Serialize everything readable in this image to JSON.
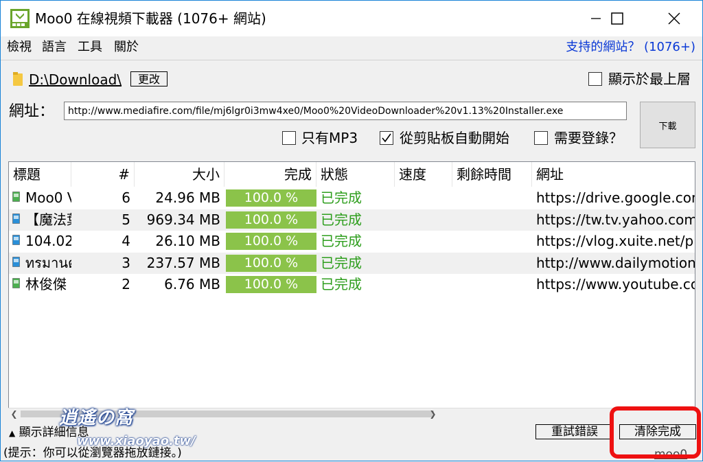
{
  "window": {
    "title": "Moo0 在線視頻下載器 (1076+ 網站)"
  },
  "menu": {
    "items": [
      "檢視",
      "語言",
      "工具",
      "關於"
    ],
    "sites_link": "支持的網站？ (1076+)"
  },
  "folder": {
    "path": "D:\\Download\\",
    "change_label": "更改",
    "on_top_label": "顯示於最上層",
    "on_top_checked": false
  },
  "url": {
    "label": "網址：",
    "value": "http://www.mediafire.com/file/mj6lgr0i3mw4xe0/Moo0%20VideoDownloader%20v1.13%20Installer.exe",
    "download_label": "下載"
  },
  "options": [
    {
      "label": "只有MP3",
      "checked": false
    },
    {
      "label": "從剪貼板自動開始",
      "checked": true
    },
    {
      "label": "需要登錄？",
      "checked": false
    }
  ],
  "table": {
    "columns": [
      "標題",
      "#",
      "大小",
      "完成",
      "狀態",
      "速度",
      "剩餘時間",
      "網址"
    ],
    "rows": [
      {
        "title": "Moo0 V",
        "num": "6",
        "size": "24.96 MB",
        "progress": "100.0 %",
        "status": "已完成",
        "speed": "",
        "remaining": "",
        "url": "https://drive.google.com",
        "icon_color": "#4caf50"
      },
      {
        "title": "【魔法葉",
        "num": "5",
        "size": "969.34 MB",
        "progress": "100.0 %",
        "status": "已完成",
        "speed": "",
        "remaining": "",
        "url": "https://tw.tv.yahoo.com",
        "icon_color": "#2a8fd8"
      },
      {
        "title": "104.02.",
        "num": "4",
        "size": "26.10 MB",
        "progress": "100.0 %",
        "status": "已完成",
        "speed": "",
        "remaining": "",
        "url": "https://vlog.xuite.net/pl",
        "icon_color": "#2a8fd8"
      },
      {
        "title": "ทรมานตัวเอ",
        "num": "3",
        "size": "237.57 MB",
        "progress": "100.0 %",
        "status": "已完成",
        "speed": "",
        "remaining": "",
        "url": "http://www.dailymotion",
        "icon_color": "#2a8fd8"
      },
      {
        "title": "林俊傑",
        "num": "2",
        "size": "6.76 MB",
        "progress": "100.0 %",
        "status": "已完成",
        "speed": "",
        "remaining": "",
        "url": "https://www.youtube.co",
        "icon_color": "#4caf50"
      }
    ]
  },
  "footer": {
    "details_label": "顯示詳細信息",
    "hint": "(提示：你可以從瀏覽器拖放鏈接。)",
    "retry_label": "重試錯誤",
    "clear_label": "清除完成",
    "moo0_link": "moo0"
  },
  "watermark": {
    "text": "逍遙の窩",
    "url": "www.xiaoyao.tw/"
  },
  "colors": {
    "progress": "#8bc34a",
    "status": "#2e9e1d",
    "link": "#0a39d6",
    "highlight": "#e11111"
  }
}
